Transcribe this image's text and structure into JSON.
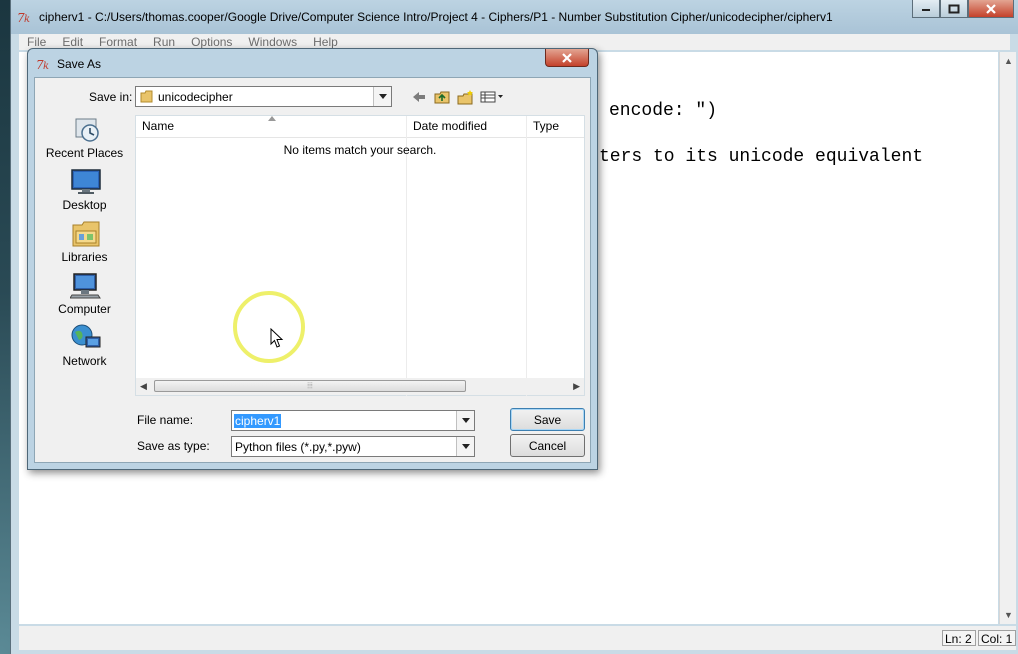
{
  "window": {
    "title": "cipherv1 - C:/Users/thomas.cooper/Google Drive/Computer Science Intro/Project 4 - Ciphers/P1 - Number Substitution Cipher/unicodecipher/cipherv1",
    "app_icon": "python-feather-icon",
    "menu": [
      "File",
      "Edit",
      "Format",
      "Run",
      "Options",
      "Windows",
      "Help"
    ]
  },
  "editor": {
    "visible_fragments": [
      "encode: \")",
      "ters to its unicode equivalent"
    ]
  },
  "status": {
    "line": "Ln: 2",
    "col": "Col: 1"
  },
  "dialog": {
    "title": "Save As",
    "save_in_label": "Save in:",
    "save_in_value": "unicodecipher",
    "places": [
      {
        "label": "Recent Places",
        "icon": "recent-places-icon"
      },
      {
        "label": "Desktop",
        "icon": "desktop-icon"
      },
      {
        "label": "Libraries",
        "icon": "libraries-icon"
      },
      {
        "label": "Computer",
        "icon": "computer-icon"
      },
      {
        "label": "Network",
        "icon": "network-icon"
      }
    ],
    "columns": [
      "Name",
      "Date modified",
      "Type"
    ],
    "empty_message": "No items match your search.",
    "file_name_label": "File name:",
    "file_name_value": "cipherv1",
    "save_type_label": "Save as type:",
    "save_type_value": "Python files (*.py,*.pyw)",
    "save_button": "Save",
    "cancel_button": "Cancel"
  }
}
